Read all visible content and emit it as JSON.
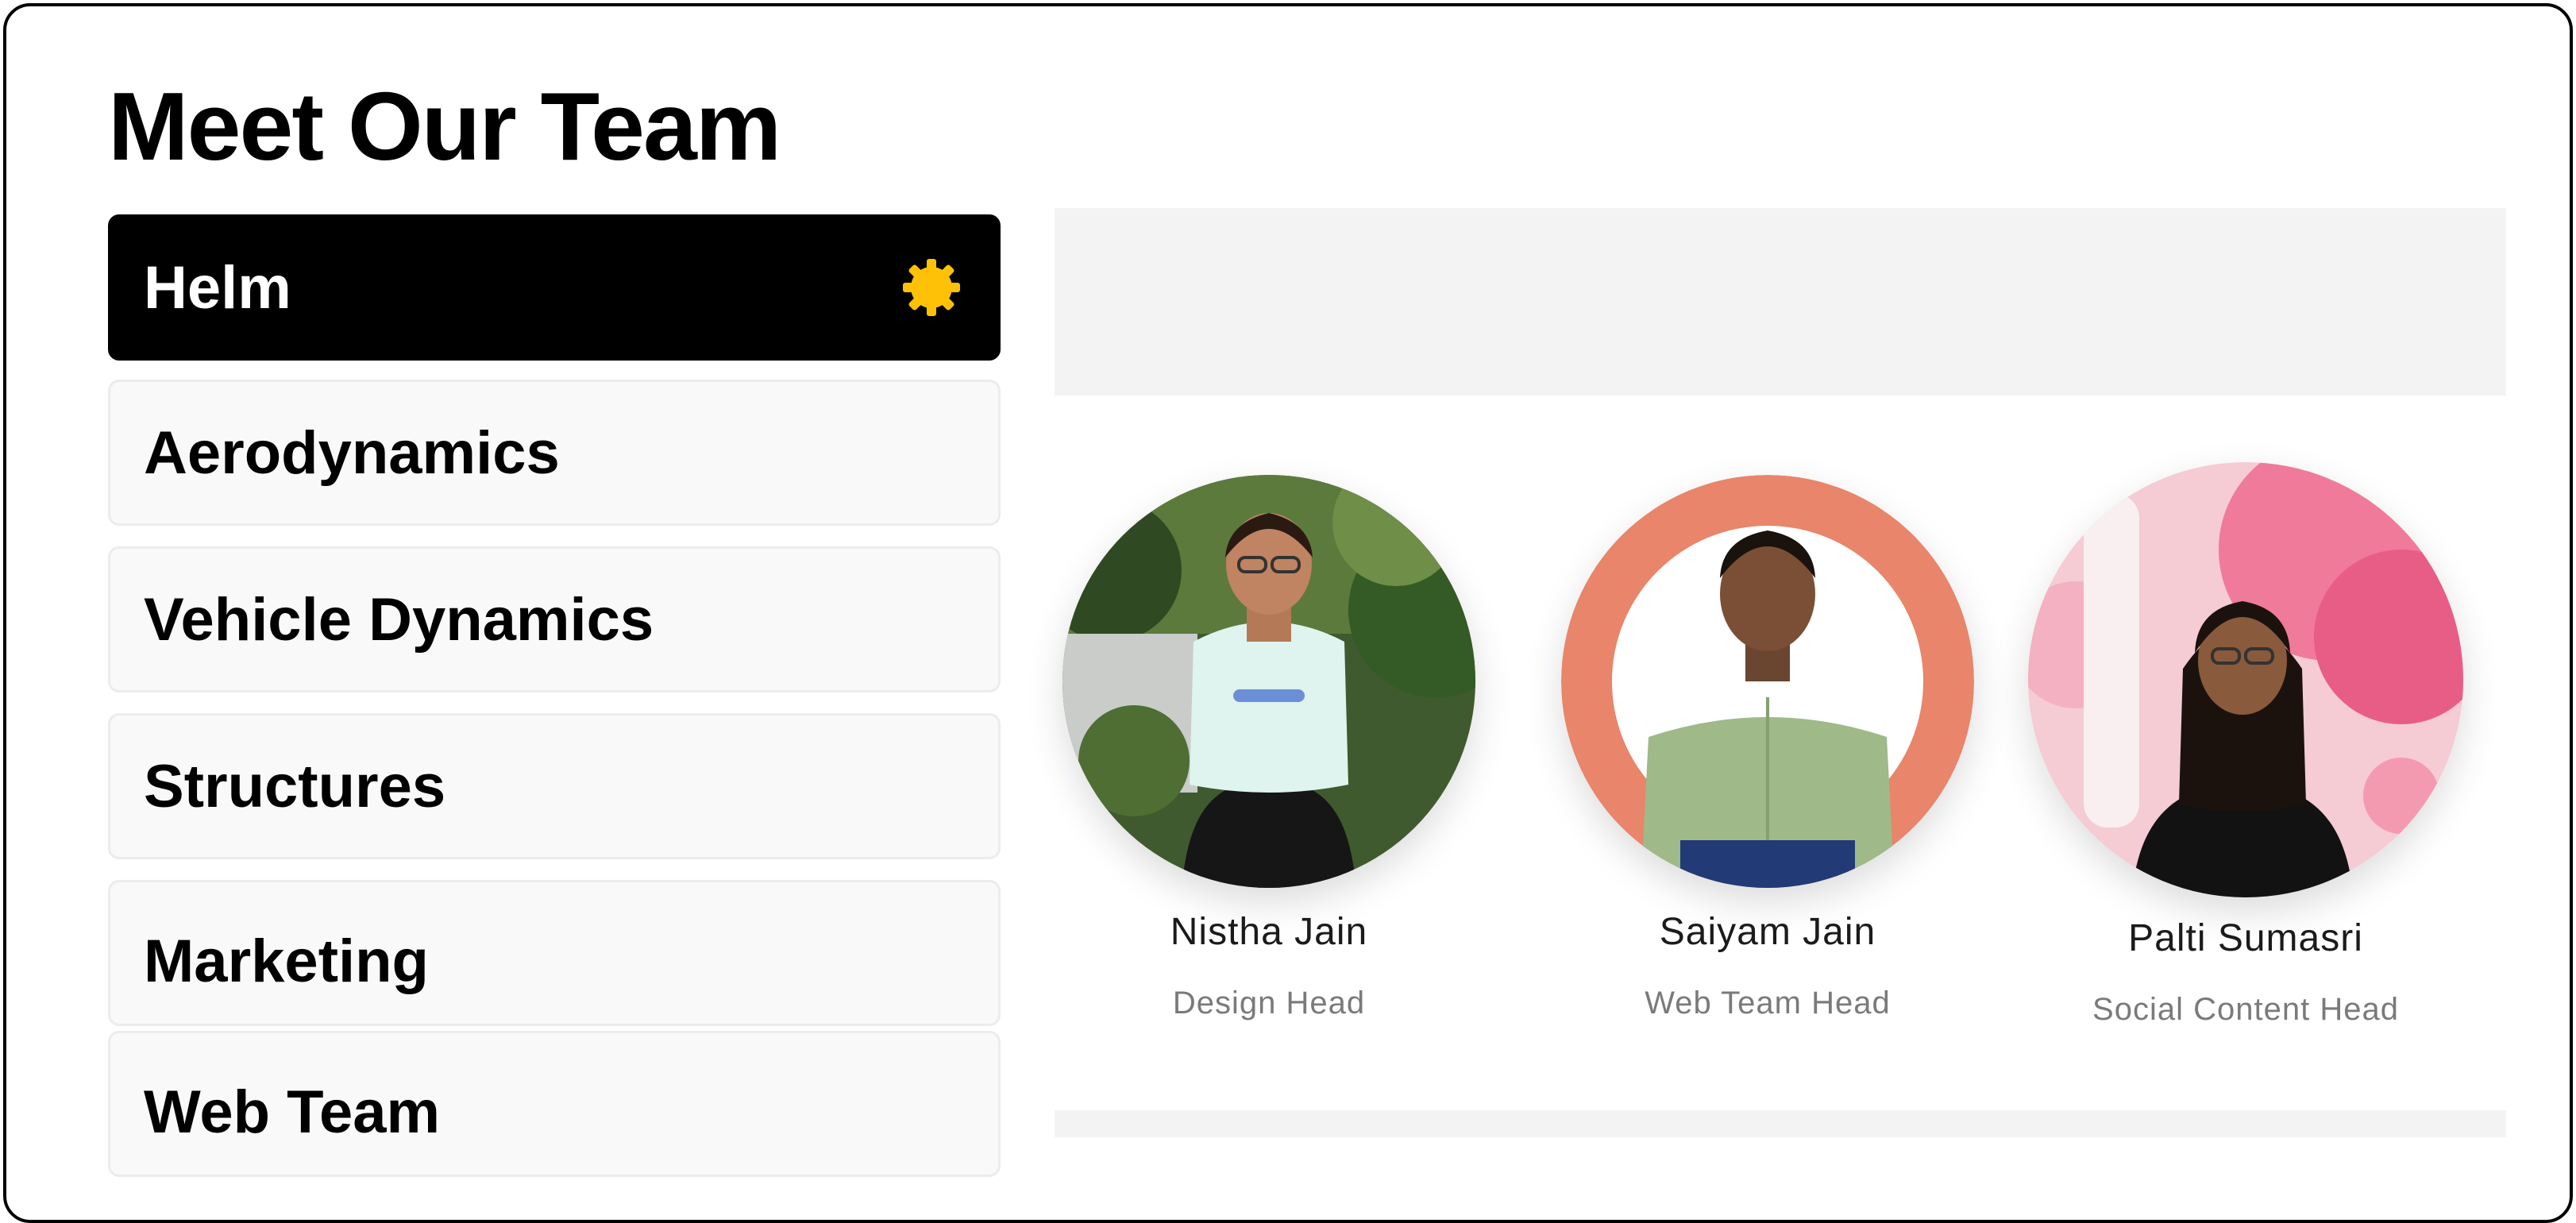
{
  "page": {
    "title": "Meet Our Team"
  },
  "tabs": [
    {
      "label": "Helm",
      "active": true
    },
    {
      "label": "Aerodynamics",
      "active": false
    },
    {
      "label": "Vehicle Dynamics",
      "active": false
    },
    {
      "label": "Structures",
      "active": false
    },
    {
      "label": "Marketing",
      "active": false
    },
    {
      "label": "Web Team",
      "active": false
    }
  ],
  "team": [
    {
      "name": "Nistha Jain",
      "role": "Design Head"
    },
    {
      "name": "Saiyam Jain",
      "role": "Web Team Head"
    },
    {
      "name": "Palti Sumasri",
      "role": "Social Content Head"
    }
  ],
  "colors": {
    "active_tab": "#000000",
    "gear_icon": "#FFC107",
    "ring_accent": "#E8856A"
  }
}
